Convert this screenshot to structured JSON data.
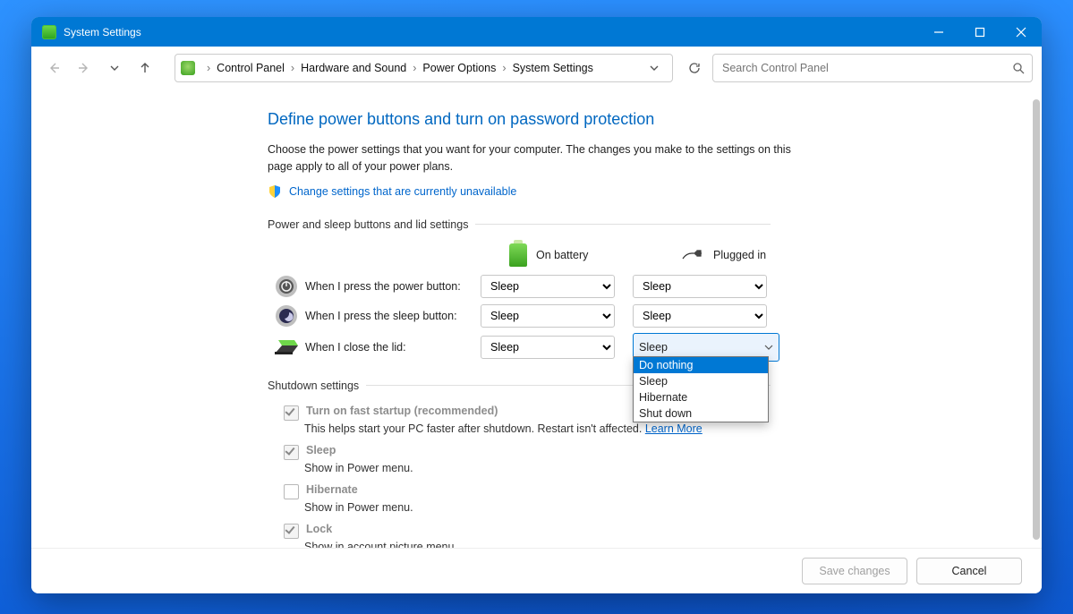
{
  "window": {
    "title": "System Settings"
  },
  "breadcrumb": {
    "items": [
      "Control Panel",
      "Hardware and Sound",
      "Power Options",
      "System Settings"
    ]
  },
  "search": {
    "placeholder": "Search Control Panel"
  },
  "page": {
    "heading": "Define power buttons and turn on password protection",
    "subtitle": "Choose the power settings that you want for your computer. The changes you make to the settings on this page apply to all of your power plans.",
    "uac_link": "Change settings that are currently unavailable"
  },
  "sections": {
    "power_sleep": "Power and sleep buttons and lid settings",
    "shutdown": "Shutdown settings"
  },
  "columns": {
    "battery": "On battery",
    "plugged": "Plugged in"
  },
  "rows": {
    "power_button": {
      "label": "When I press the power button:",
      "battery": "Sleep",
      "plugged": "Sleep"
    },
    "sleep_button": {
      "label": "When I press the sleep button:",
      "battery": "Sleep",
      "plugged": "Sleep"
    },
    "close_lid": {
      "label": "When I close the lid:",
      "battery": "Sleep",
      "plugged": "Sleep"
    }
  },
  "dropdown": {
    "options": [
      "Do nothing",
      "Sleep",
      "Hibernate",
      "Shut down"
    ],
    "highlighted": "Do nothing"
  },
  "shutdown": {
    "fast_startup": {
      "label": "Turn on fast startup (recommended)",
      "desc": "This helps start your PC faster after shutdown. Restart isn't affected. ",
      "learn_more": "Learn More",
      "checked": true
    },
    "sleep": {
      "label": "Sleep",
      "desc": "Show in Power menu.",
      "checked": true
    },
    "hibernate": {
      "label": "Hibernate",
      "desc": "Show in Power menu.",
      "checked": false
    },
    "lock": {
      "label": "Lock",
      "desc": "Show in account picture menu.",
      "checked": true
    }
  },
  "footer": {
    "save": "Save changes",
    "cancel": "Cancel"
  }
}
